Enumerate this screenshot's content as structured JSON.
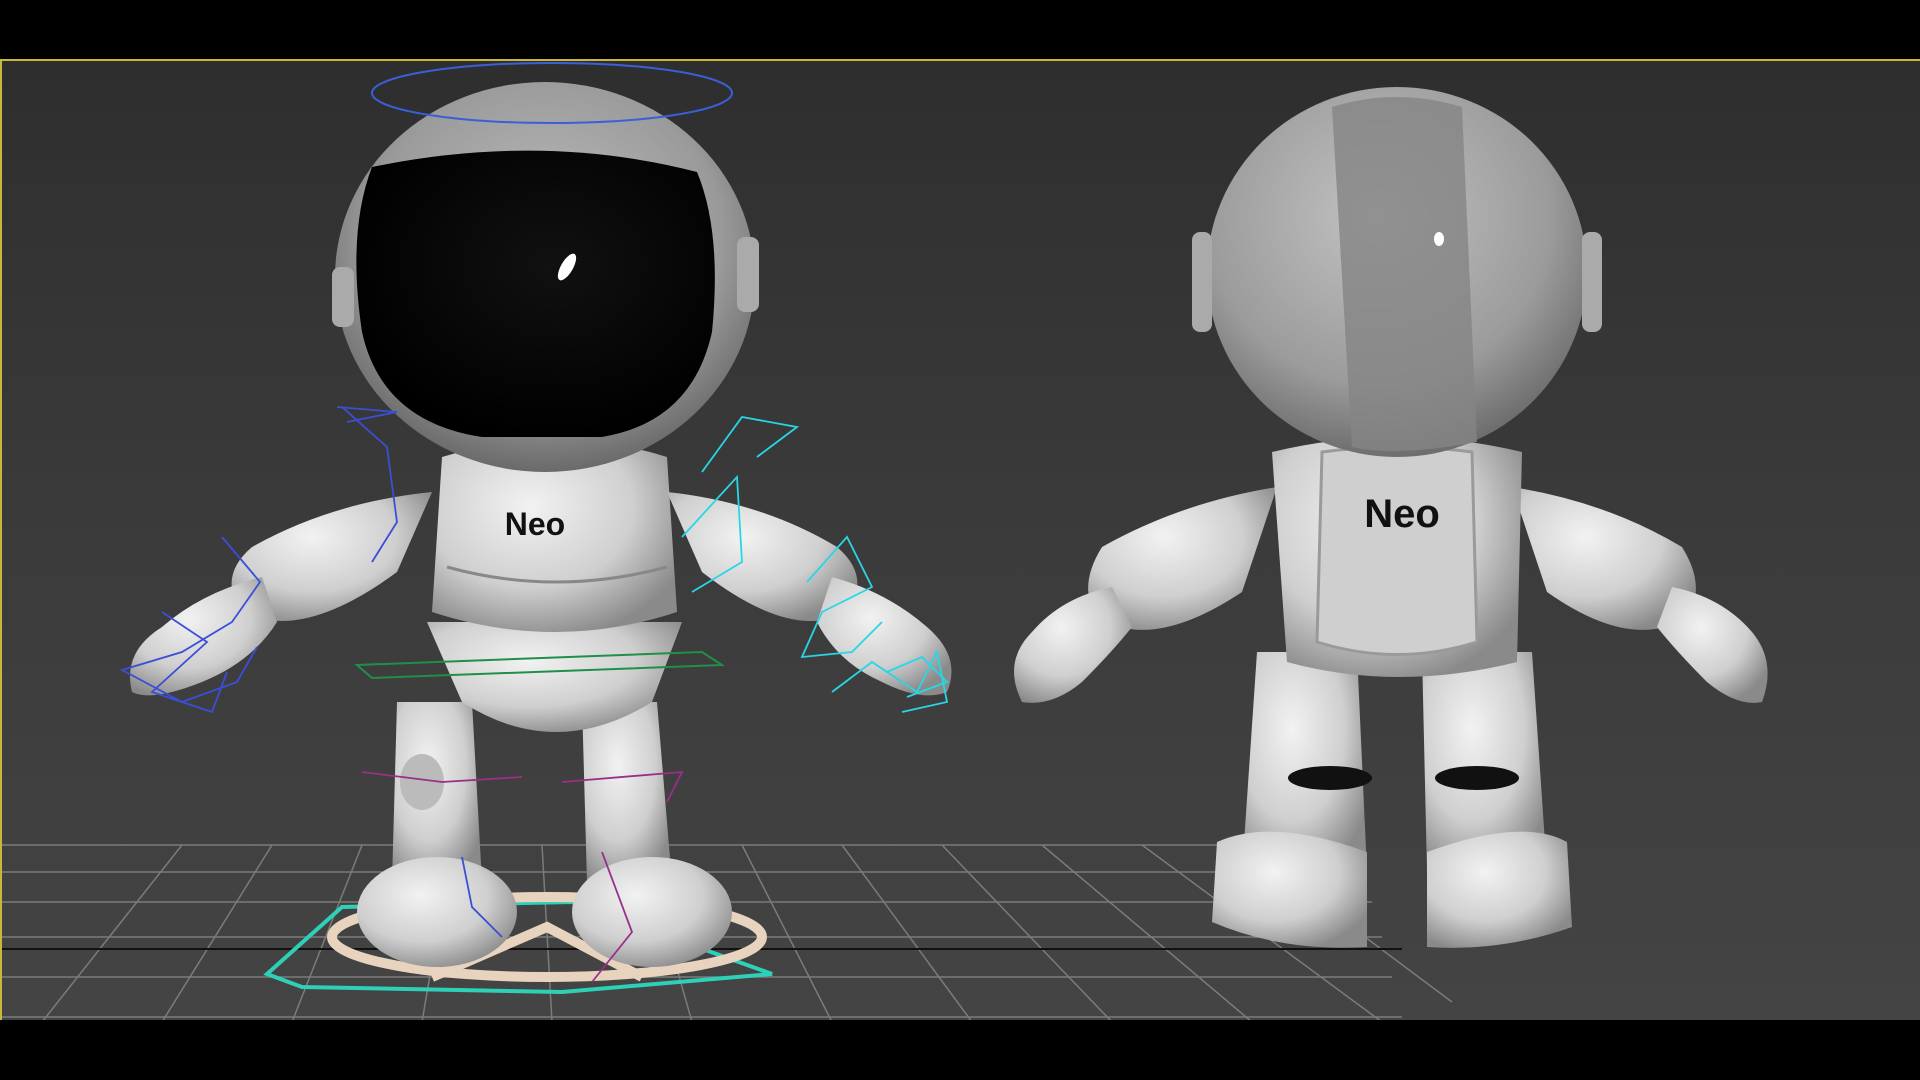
{
  "viewport": {
    "border_color": "#c9b73a",
    "background": "#3a3a3a",
    "grid_color": "#8a8a8a"
  },
  "front_character": {
    "chest_logo": "Neo"
  },
  "back_character": {
    "back_logo": "Neo"
  },
  "rig_colors": {
    "left_controls": "#3b4fd6",
    "right_controls": "#27d7e6",
    "root_control": "#2fd0b8",
    "hip_plane": "#1f8f4a",
    "legs": "#9a2f8a",
    "halo": "#3a5fd8"
  }
}
